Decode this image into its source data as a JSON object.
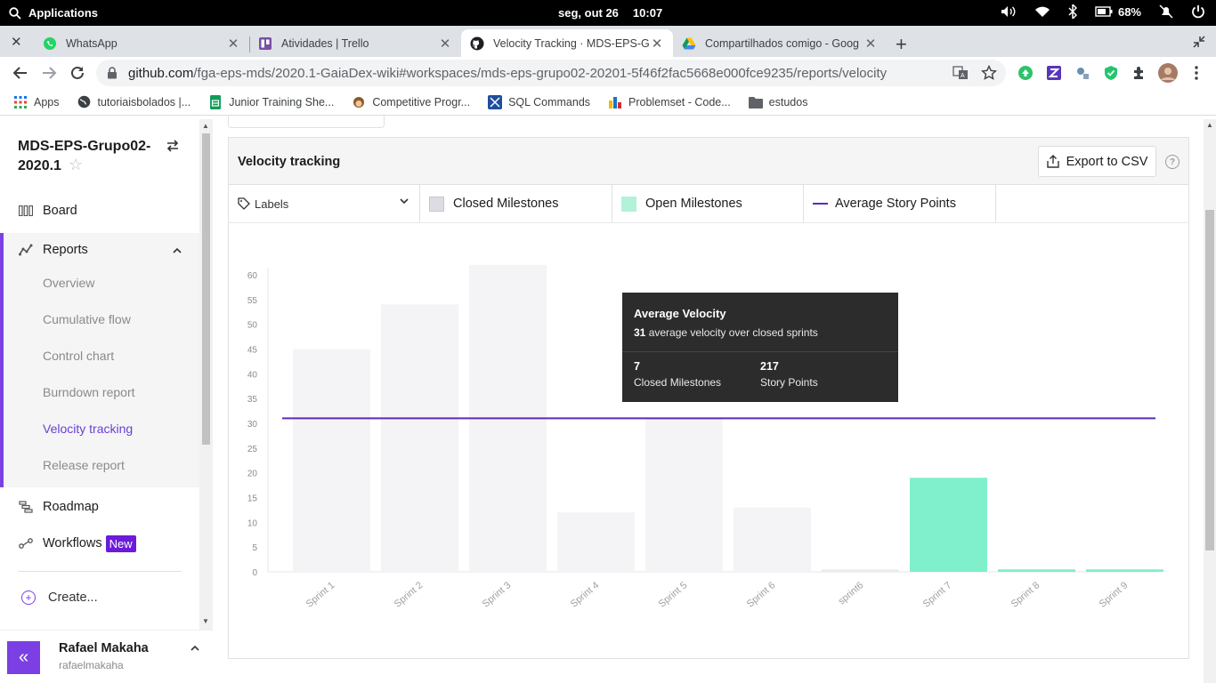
{
  "os": {
    "apps_label": "Applications",
    "date": "seg, out 26",
    "time": "10:07",
    "battery": "68%"
  },
  "tabs": [
    {
      "title": "WhatsApp"
    },
    {
      "title": "Atividades | Trello"
    },
    {
      "title": "Velocity Tracking · MDS-EPS-Gr"
    },
    {
      "title": "Compartilhados comigo - Goog"
    }
  ],
  "address": {
    "url_host": "github.com",
    "url_path": "/fga-eps-mds/2020.1-GaiaDex-wiki#workspaces/mds-eps-grupo02-20201-5f46f2fac5668e000fce9235/reports/velocity"
  },
  "bookmarks": [
    {
      "label": "Apps"
    },
    {
      "label": "tutoriaisbolados |..."
    },
    {
      "label": "Junior Training She..."
    },
    {
      "label": "Competitive Progr..."
    },
    {
      "label": "SQL Commands"
    },
    {
      "label": "Problemset - Code..."
    },
    {
      "label": "estudos"
    }
  ],
  "sidebar": {
    "workspace_title": "MDS-EPS-Grupo02-2020.1",
    "board": "Board",
    "reports": "Reports",
    "report_items": [
      {
        "label": "Overview"
      },
      {
        "label": "Cumulative flow"
      },
      {
        "label": "Control chart"
      },
      {
        "label": "Burndown report"
      },
      {
        "label": "Velocity tracking"
      },
      {
        "label": "Release report"
      }
    ],
    "roadmap": "Roadmap",
    "workflows": "Workflows",
    "workflows_badge": "New",
    "create": "Create...",
    "user_name": "Rafael Makaha",
    "user_login": "rafaelmakaha"
  },
  "panel": {
    "title": "Velocity tracking",
    "export_label": "Export to CSV",
    "labels_select": "Labels",
    "legend": {
      "closed": "Closed Milestones",
      "open": "Open Milestones",
      "avg": "Average Story Points"
    }
  },
  "tooltip": {
    "title": "Average Velocity",
    "avg_value": "31",
    "avg_text": " average velocity over closed sprints",
    "closed_count": "7",
    "closed_label": "Closed Milestones",
    "story_points": "217",
    "story_label": "Story Points"
  },
  "colors": {
    "closed": "#f4f4f6",
    "open": "#7ff0cb",
    "avg_line": "#5b2bb8",
    "accent": "#7b3fe4"
  },
  "chart_data": {
    "type": "bar",
    "categories": [
      "Sprint 1",
      "Sprint 2",
      "Sprint 3",
      "Sprint 4",
      "Sprint 5",
      "Sprint 6",
      "sprint6",
      "Sprint 7",
      "Sprint 8",
      "Sprint 9"
    ],
    "series": [
      {
        "name": "Closed Milestones",
        "values": [
          45,
          54,
          62,
          12,
          31,
          13,
          0.5,
          null,
          null,
          null
        ]
      },
      {
        "name": "Open Milestones",
        "values": [
          null,
          null,
          null,
          null,
          null,
          null,
          null,
          19,
          0.5,
          0.5
        ]
      }
    ],
    "average": 31,
    "ylim": [
      0,
      60
    ],
    "yticks": [
      0,
      5,
      10,
      15,
      20,
      25,
      30,
      35,
      40,
      45,
      50,
      55,
      60
    ]
  }
}
